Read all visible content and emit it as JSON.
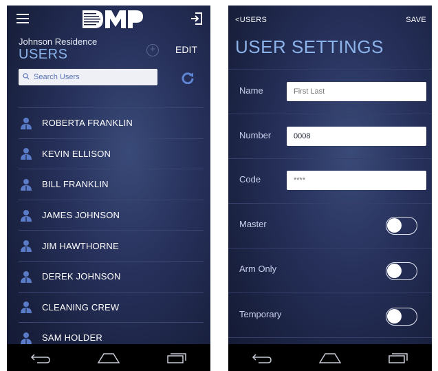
{
  "left_screen": {
    "residence": "Johnson Residence",
    "title": "USERS",
    "edit_label": "EDIT",
    "add_symbol": "+",
    "search": {
      "placeholder": "Search Users",
      "value": ""
    },
    "users": [
      "ROBERTA FRANKLIN",
      "KEVIN ELLISON",
      "BILL FRANKLIN",
      "JAMES JOHNSON",
      "JIM HAWTHORNE",
      "DEREK JOHNSON",
      "CLEANING CREW",
      "SAM HOLDER"
    ]
  },
  "right_screen": {
    "back_label": "<USERS",
    "save_label": "SAVE",
    "title": "USER SETTINGS",
    "fields": {
      "name": {
        "label": "Name",
        "placeholder": "First Last",
        "value": ""
      },
      "number": {
        "label": "Number",
        "value": "0008"
      },
      "code": {
        "label": "Code",
        "placeholder": "****",
        "value": ""
      }
    },
    "toggles": {
      "master": {
        "label": "Master",
        "state": "off"
      },
      "arm_only": {
        "label": "Arm Only",
        "state": "off"
      },
      "temporary": {
        "label": "Temporary",
        "state": "off"
      }
    }
  },
  "icons": {
    "menu": "hamburger-menu-icon",
    "logo": "dmp-logo",
    "logout": "logout-icon",
    "add": "add-circle-icon",
    "search": "search-icon",
    "refresh": "refresh-icon",
    "user": "person-icon",
    "nav_back": "back-arrow-icon",
    "nav_home": "home-icon",
    "nav_recents": "recents-icon"
  },
  "colors": {
    "background_dark": "#181f3c",
    "title_accent": "#8cb3ea",
    "user_icon": "#5a7bc8",
    "navbar": "#000000"
  }
}
